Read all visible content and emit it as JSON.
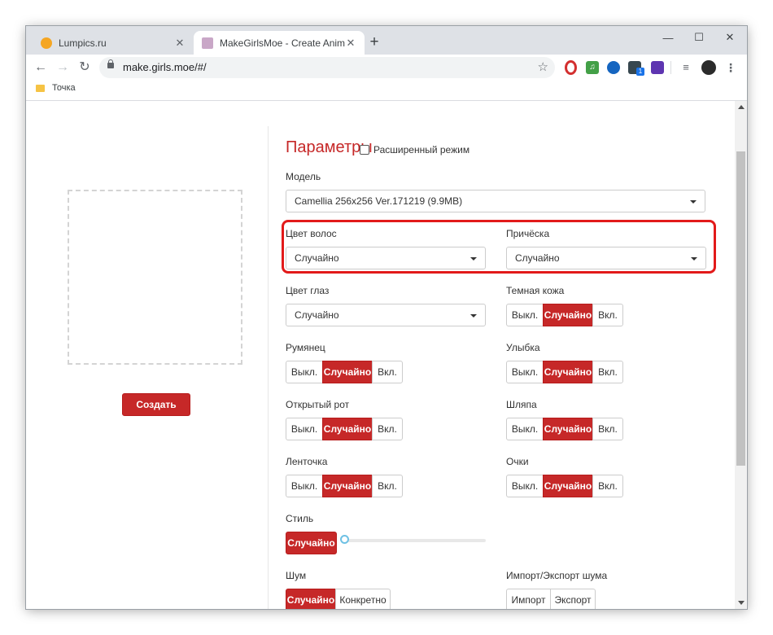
{
  "browser": {
    "tabs": [
      {
        "title": "Lumpics.ru",
        "favicon_color": "#f5a623"
      },
      {
        "title": "MakeGirlsMoe - Create Anime Ch",
        "favicon_color": "#c9a7c7"
      }
    ],
    "new_tab": "+",
    "window_controls": {
      "minimize": "—",
      "maximize": "☐",
      "close": "✕"
    },
    "nav": {
      "back": "←",
      "forward": "→",
      "reload": "↻"
    },
    "url": "make.girls.moe/#/",
    "bookmark": "Точка",
    "extension_badge": "1"
  },
  "sidebar": {
    "create_button": "Создать"
  },
  "params": {
    "title": "Параметры",
    "advanced_mode": "Расширенный режим",
    "model_label": "Модель",
    "model_value": "Camellia 256x256 Ver.171219 (9.9MB)",
    "hair_color_label": "Цвет волос",
    "hair_color_value": "Случайно",
    "hairstyle_label": "Причёска",
    "hairstyle_value": "Случайно",
    "eye_color_label": "Цвет глаз",
    "eye_color_value": "Случайно",
    "dark_skin_label": "Темная кожа",
    "blush_label": "Румянец",
    "smile_label": "Улыбка",
    "open_mouth_label": "Открытый рот",
    "hat_label": "Шляпа",
    "ribbon_label": "Ленточка",
    "glasses_label": "Очки",
    "toggle": {
      "off": "Выкл.",
      "random": "Случайно",
      "on": "Вкл."
    },
    "style_label": "Стиль",
    "style_value": "Случайно",
    "noise_label": "Шум",
    "noise_random": "Случайно",
    "noise_fixed": "Конкретно",
    "import_export_label": "Импорт/Экспорт шума",
    "import": "Импорт",
    "export": "Экспорт"
  },
  "colors": {
    "accent": "#c62828",
    "highlight": "#e21a1a"
  }
}
